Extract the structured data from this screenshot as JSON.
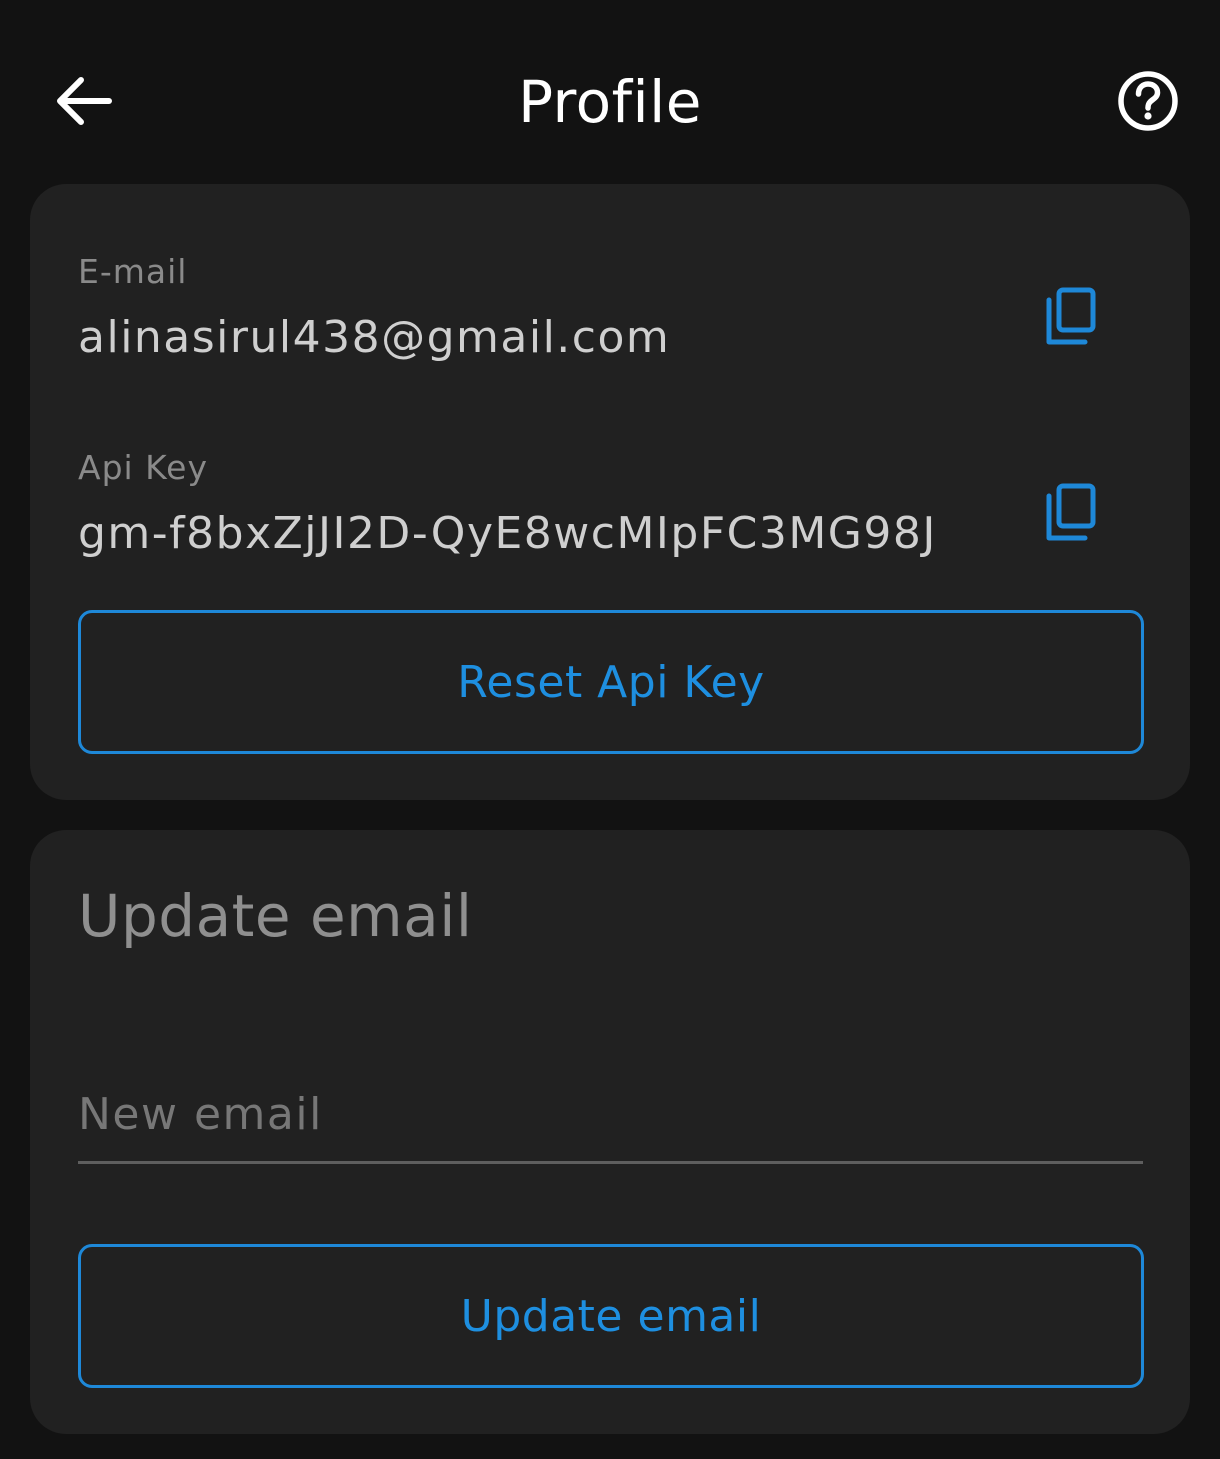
{
  "header": {
    "title": "Profile",
    "back_icon": "arrow-left-icon",
    "help_icon": "help-circle-icon"
  },
  "account": {
    "email_label": "E-mail",
    "email_value": "alinasirul438@gmail.com",
    "api_key_label": "Api Key",
    "api_key_value": "gm-f8bxZjJI2D-QyE8wcMIpFC3MG98J",
    "copy_icon": "copy-icon",
    "reset_button_label": "Reset Api Key"
  },
  "update_email": {
    "section_title": "Update email",
    "input_placeholder": "New email",
    "input_value": "",
    "button_label": "Update email"
  },
  "colors": {
    "background": "#121212",
    "card": "#212121",
    "accent": "#1e8fe0",
    "label": "#8a8a8a",
    "value": "#cfcfcf"
  }
}
